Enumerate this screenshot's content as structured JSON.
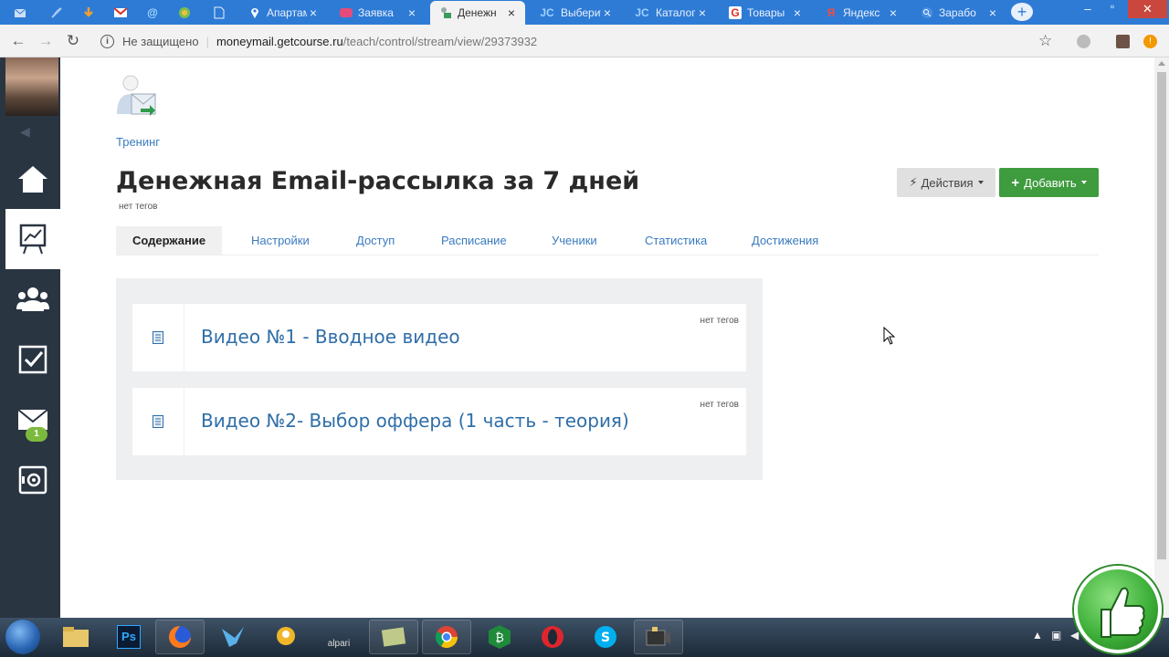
{
  "browser": {
    "tabs": [
      {
        "id": "t0",
        "title": "",
        "icon": "mail-icon"
      },
      {
        "id": "t1",
        "title": "",
        "icon": "feather-icon"
      },
      {
        "id": "t2",
        "title": "",
        "icon": "download-icon"
      },
      {
        "id": "t3",
        "title": "",
        "icon": "gmail-icon"
      },
      {
        "id": "t4",
        "title": "",
        "icon": "at-sign-icon"
      },
      {
        "id": "t5",
        "title": "",
        "icon": "globe-icon"
      },
      {
        "id": "t6",
        "title": "",
        "icon": "document-icon"
      },
      {
        "id": "t7",
        "title": "Апартам",
        "icon": "map-pin-icon"
      },
      {
        "id": "t8",
        "title": "Заявка",
        "icon": "form-icon"
      },
      {
        "id": "t9",
        "title": "Денежн",
        "icon": "getcourse-icon"
      },
      {
        "id": "t10",
        "title": "Выберит",
        "icon": "jc-icon",
        "icon_text": "JC"
      },
      {
        "id": "t11",
        "title": "Каталог",
        "icon": "jc-icon",
        "icon_text": "JC"
      },
      {
        "id": "t12",
        "title": "Товары",
        "icon": "google-icon",
        "icon_text": "G"
      },
      {
        "id": "t13",
        "title": "Яндекс",
        "icon": "yandex-icon",
        "icon_text": "Я"
      },
      {
        "id": "t14",
        "title": "Зарабо",
        "icon": "search-icon"
      }
    ],
    "active_tab_index": 9,
    "url": {
      "security_text": "Не защищено",
      "host": "moneymail.getcourse.ru",
      "path": "/teach/control/stream/view/29373932"
    }
  },
  "sidebar": {
    "badge_count": "1",
    "items": [
      {
        "name": "home",
        "icon": "home-icon"
      },
      {
        "name": "training",
        "icon": "chart-board-icon",
        "active": true
      },
      {
        "name": "users",
        "icon": "users-icon"
      },
      {
        "name": "tasks",
        "icon": "checkbox-icon"
      },
      {
        "name": "messages",
        "icon": "envelope-icon"
      },
      {
        "name": "settings",
        "icon": "safe-icon"
      }
    ]
  },
  "page": {
    "breadcrumb": "Тренинг",
    "title": "Денежная Email-рассылка за 7 дней",
    "tags_text": "нет тегов",
    "actions_label": "Действия",
    "add_label": "Добавить",
    "tabs": [
      {
        "label": "Содержание",
        "active": true
      },
      {
        "label": "Настройки"
      },
      {
        "label": "Доступ"
      },
      {
        "label": "Расписание"
      },
      {
        "label": "Ученики"
      },
      {
        "label": "Статистика"
      },
      {
        "label": "Достижения"
      }
    ],
    "lessons": [
      {
        "title": "Видео №1 - Вводное видео",
        "tags": "нет тегов"
      },
      {
        "title": "Видео №2- Выбор оффера (1 часть - теория)",
        "tags": "нет тегов"
      }
    ]
  },
  "taskbar": {
    "items": [
      {
        "name": "explorer",
        "icon": "folder-icon"
      },
      {
        "name": "photoshop",
        "icon": "photoshop-icon",
        "label": "Ps"
      },
      {
        "name": "firefox",
        "icon": "firefox-icon"
      },
      {
        "name": "hummingbird",
        "icon": "bird-icon"
      },
      {
        "name": "agent",
        "icon": "chat-icon"
      },
      {
        "name": "alpari",
        "icon": "alpari-icon",
        "label": "alpari"
      },
      {
        "name": "notes",
        "icon": "notepad-icon"
      },
      {
        "name": "chrome",
        "icon": "chrome-icon"
      },
      {
        "name": "bitcoin",
        "icon": "bitcoin-icon"
      },
      {
        "name": "opera",
        "icon": "opera-icon"
      },
      {
        "name": "skype",
        "icon": "skype-icon"
      },
      {
        "name": "camera",
        "icon": "video-camera-icon"
      }
    ]
  },
  "colors": {
    "tabstrip": "#2e7bd6",
    "sidebar": "#2a3542",
    "link": "#3a7bbf",
    "add_button": "#3e9b3e",
    "actions_button": "#e0e0e0"
  }
}
